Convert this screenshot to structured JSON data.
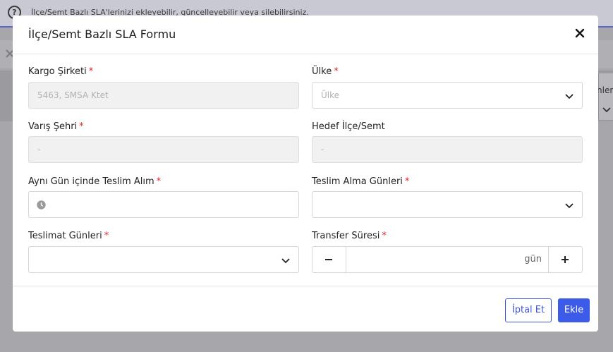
{
  "background": {
    "info_text": "İlçe/Semt Bazlı SLA'lerinizi ekleyebilir, güncelleyebilir veya silebilirsiniz.",
    "info_icon": "?",
    "right_label": "nler"
  },
  "modal": {
    "title": "İlçe/Semt Bazlı SLA Formu",
    "close_icon": "close-icon"
  },
  "form": {
    "cargo_company": {
      "label": "Kargo Şirketi",
      "required": "*",
      "value": "5463, SMSA Ktet"
    },
    "country": {
      "label": "Ülke",
      "required": "*",
      "placeholder": "Ülke"
    },
    "destination_city": {
      "label": "Varış Şehri",
      "required": "*",
      "value": "-"
    },
    "target_district": {
      "label": "Hedef İlçe/Semt",
      "value": "-"
    },
    "same_day_pickup": {
      "label": "Aynı Gün içinde Teslim Alım",
      "required": "*",
      "value": ""
    },
    "pickup_days": {
      "label": "Teslim Alma Günleri",
      "required": "*",
      "value": ""
    },
    "delivery_days": {
      "label": "Teslimat Günleri",
      "required": "*",
      "value": ""
    },
    "transfer_time": {
      "label": "Transfer Süresi",
      "required": "*",
      "unit": "gün",
      "value": ""
    }
  },
  "footer": {
    "cancel_label": "İptal Et",
    "add_label": "Ekle"
  },
  "colors": {
    "accent": "#3b5be8",
    "required": "#e0272b"
  }
}
